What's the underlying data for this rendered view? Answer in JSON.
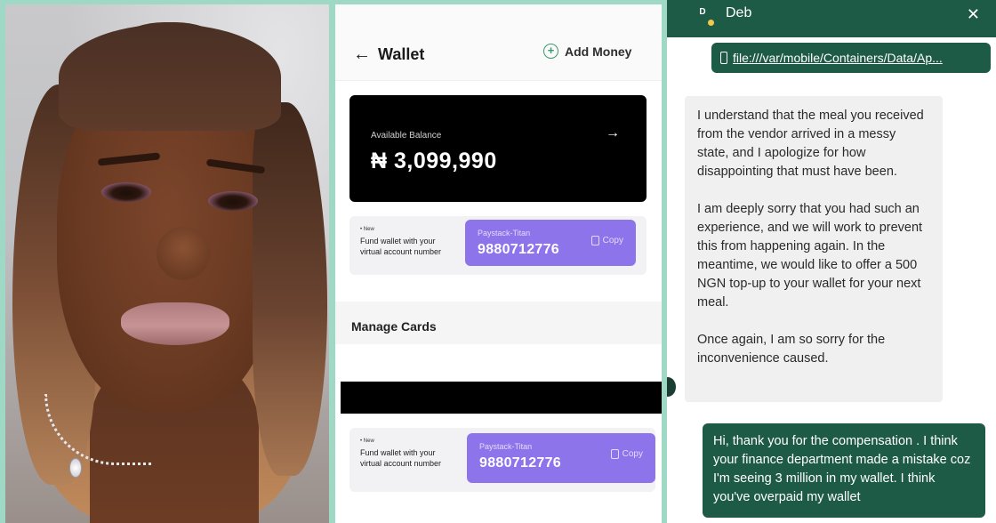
{
  "wallet": {
    "back_icon": "arrow-left-icon",
    "title": "Wallet",
    "add_money_label": "Add Money",
    "add_icon": "plus-circle-icon",
    "balance_label": "Available Balance",
    "balance_amount": "₦ 3,099,990",
    "balance_arrow": "→",
    "fund_cards": [
      {
        "badge": "• New",
        "description": "Fund wallet with your virtual account number",
        "bank": "Paystack-Titan",
        "account_number": "9880712776",
        "copy_label": "Copy"
      },
      {
        "badge": "• New",
        "description": "Fund wallet with your virtual account number",
        "bank": "Paystack-Titan",
        "account_number": "9880712776",
        "copy_label": "Copy"
      }
    ],
    "manage_cards_label": "Manage Cards"
  },
  "chat": {
    "avatar_initial": "D",
    "contact_name": "Deb",
    "close_label": "✕",
    "file_link": "file:///var/mobile/Containers/Data/Ap...",
    "incoming_message": [
      "I understand that the meal you received from the vendor arrived in a messy state, and I apologize for how disappointing that must have been.",
      "I am deeply sorry that you had such an experience, and we will work to prevent this from happening again. In the meantime, we would like to offer a 500 NGN top-up to your wallet for your next meal.",
      "Once again, I am so sorry for the inconvenience caused."
    ],
    "outgoing_message": "Hi, thank you for the compensation . I think your finance department made a mistake coz I'm seeing 3 million in my wallet. I think you've overpaid my wallet"
  },
  "colors": {
    "background": "#9fd9c6",
    "chat_green": "#1e5b47",
    "account_purple": "#8e74ea",
    "add_money_green": "#3a9a6a"
  }
}
